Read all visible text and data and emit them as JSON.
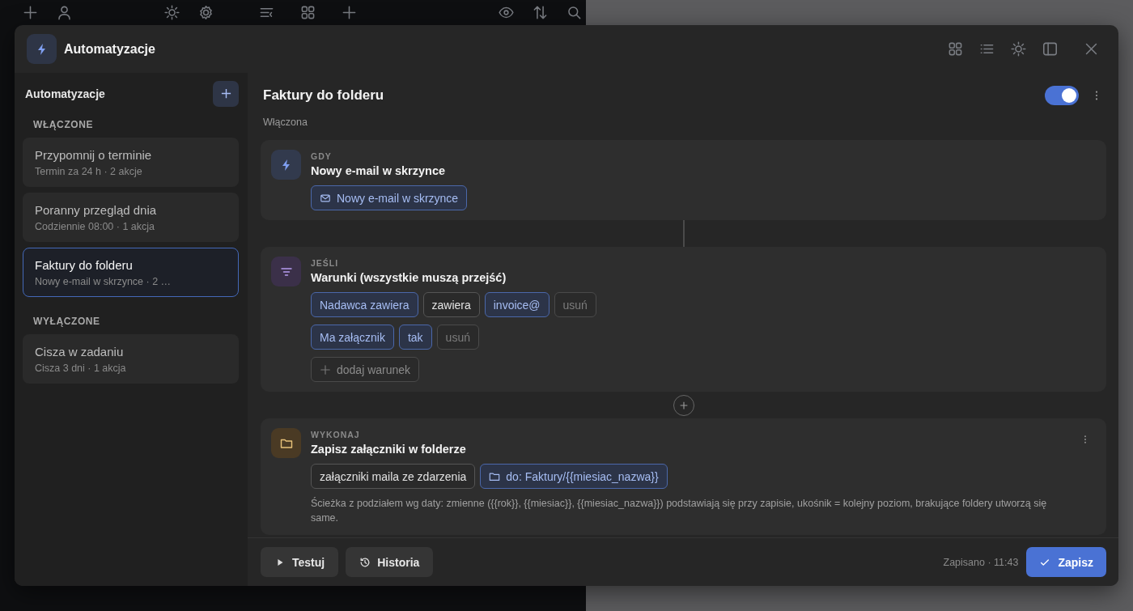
{
  "window": {
    "title": "Automatyzacje"
  },
  "sidebar": {
    "title": "Automatyzacje",
    "groups": [
      {
        "label": "WŁĄCZONE",
        "items": [
          {
            "name": "Przypomnij o terminie",
            "detail": "Termin za 24 h · 2 akcje",
            "selected": false
          },
          {
            "name": "Poranny przegląd dnia",
            "detail": "Codziennie 08:00 · 1 akcja",
            "selected": false
          },
          {
            "name": "Faktury do folderu",
            "detail": "Nowy e-mail w skrzynce · 2 …",
            "selected": true
          }
        ]
      },
      {
        "label": "WYŁĄCZONE",
        "items": [
          {
            "name": "Cisza w zadaniu",
            "detail": "Cisza 3 dni · 1 akcja",
            "selected": false
          }
        ]
      }
    ]
  },
  "automation": {
    "title": "Faktury do folderu",
    "status": "Włączona",
    "enabled": true
  },
  "steps": [
    {
      "kind": "trigger",
      "label": "GDY",
      "title": "Nowy e-mail w skrzynce",
      "event": "Nowy e-mail w skrzynce"
    },
    {
      "kind": "condition",
      "label": "JEŚLI",
      "title": "Warunki (wszystkie muszą przejść)",
      "conditions": [
        {
          "field": "Nadawca zawiera",
          "operator": "zawiera",
          "value": "invoice@",
          "remove": "usuń"
        },
        {
          "field": "Ma załącznik",
          "value": "tak",
          "remove": "usuń"
        }
      ],
      "add_label": "dodaj warunek"
    },
    {
      "kind": "action",
      "label": "WYKONAJ",
      "title": "Zapisz załączniki w folderze",
      "source": "załączniki maila ze zdarzenia",
      "target": "do: Faktury/{{miesiac_nazwa}}",
      "note": "Ścieżka z podziałem wg daty: zmienne ({{rok}}, {{miesiac}}, {{miesiac_nazwa}}) podstawiają się przy zapisie, ukośnik = kolejny poziom, brakujące foldery utworzą się same."
    }
  ],
  "connectors": [
    {
      "kind": "line"
    },
    {
      "kind": "add"
    }
  ],
  "footer": {
    "buttons": [
      {
        "kind": "test",
        "label": "Testuj"
      },
      {
        "kind": "history",
        "label": "Historia"
      }
    ],
    "status": "Zapisano · 11:43",
    "save": "Zapisz"
  }
}
